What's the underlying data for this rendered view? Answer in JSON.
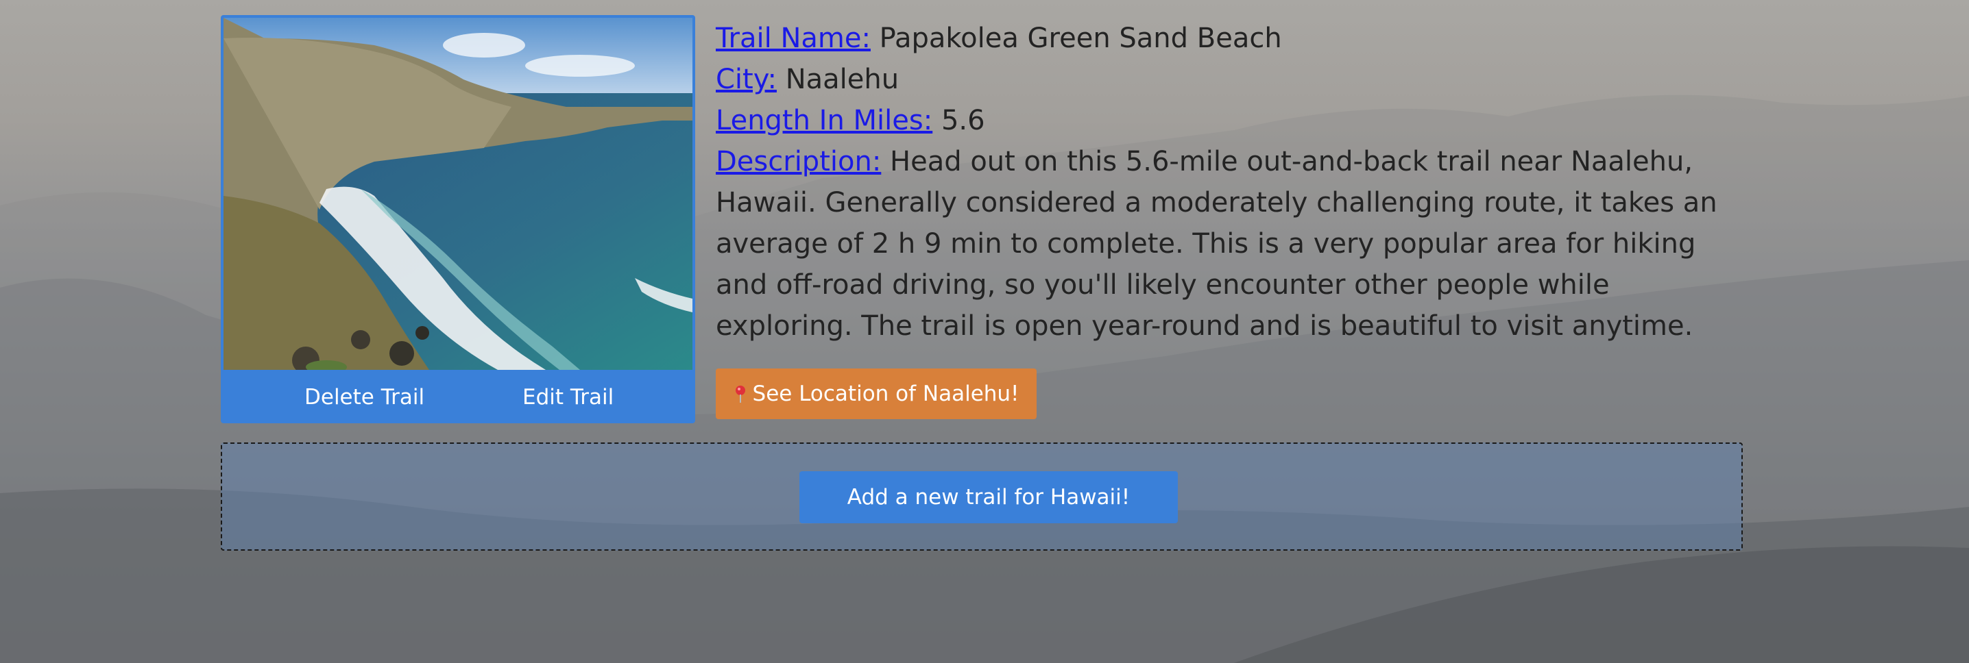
{
  "trail": {
    "name_label": "Trail Name:",
    "name": "Papakolea Green Sand Beach",
    "city_label": "City:",
    "city": "Naalehu",
    "length_label": "Length In Miles:",
    "length": "5.6",
    "description_label": "Description:",
    "description": "Head out on this 5.6-mile out-and-back trail near Naalehu, Hawaii. Generally considered a moderately challenging route, it takes an average of 2 h 9 min to complete. This is a very popular area for hiking and off-road driving, so you'll likely encounter other people while exploring. The trail is open year-round and is beautiful to visit anytime."
  },
  "card": {
    "delete_label": "Delete Trail",
    "edit_label": "Edit Trail"
  },
  "location_button": {
    "icon": "map-pin-icon",
    "label": "See Location of Naalehu!"
  },
  "add_section": {
    "button_label": "Add a new trail for Hawaii!"
  },
  "colors": {
    "primary_blue": "#3a80d9",
    "location_orange": "#d8803a",
    "link_blue": "#1a1ae6"
  }
}
